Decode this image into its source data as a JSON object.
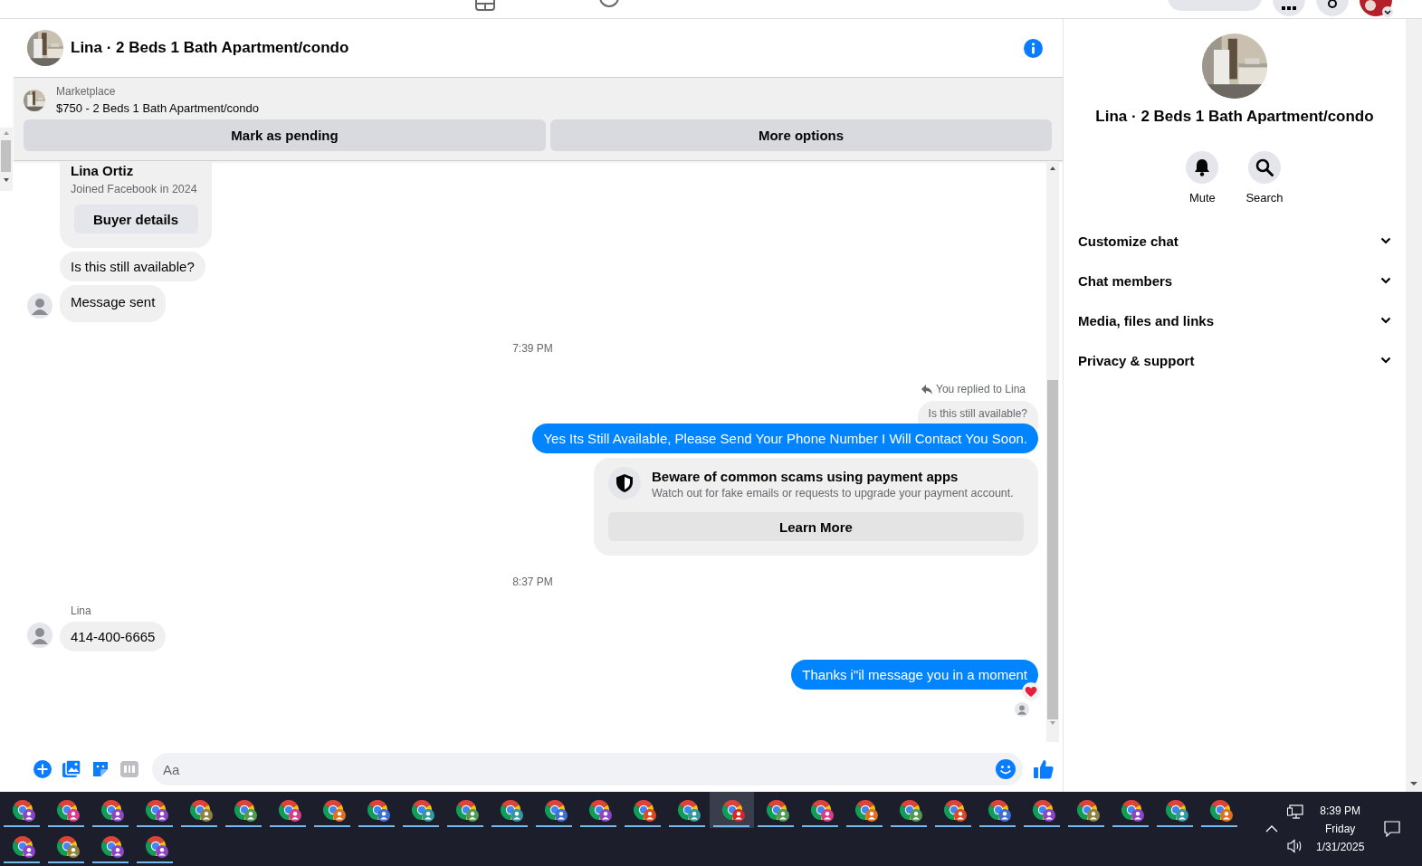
{
  "chat": {
    "title": "Lina · 2 Beds 1 Bath Apartment/condo",
    "listing": {
      "source": "Marketplace",
      "item": "$750 - 2 Beds 1 Bath Apartment/condo"
    },
    "actions": [
      "Mark as pending",
      "More options"
    ],
    "messages": [
      {
        "kind": "buyer_card",
        "name": "Lina Ortiz",
        "note": "Joined Facebook in 2024",
        "button": "Buyer details"
      },
      {
        "kind": "incoming",
        "text": "Is this still available?",
        "avatar": false
      },
      {
        "kind": "incoming",
        "text": "Message sent",
        "avatar": true
      },
      {
        "kind": "time",
        "text": "7:39 PM"
      },
      {
        "kind": "reply",
        "label": "You replied to Lina",
        "quoted": "Is this still available?",
        "text": "Yes Its Still Available, Please Send Your Phone Number I Will Contact You Soon."
      },
      {
        "kind": "warning",
        "title": "Beware of common scams using payment apps",
        "text": "Watch out for fake emails or requests to upgrade your payment account.",
        "button": "Learn More"
      },
      {
        "kind": "time",
        "text": "8:37 PM"
      },
      {
        "kind": "incoming",
        "sender": "Lina",
        "text": "414-400-6665",
        "avatar": true
      },
      {
        "kind": "outgoing",
        "text": "Thanks i\"il message you in a moment",
        "reacted": true,
        "seen": true
      }
    ],
    "composer": {
      "placeholder": "Aa"
    }
  },
  "details": {
    "title": "Lina · 2 Beds 1 Bath Apartment/condo",
    "actions": [
      {
        "kind": "mute",
        "label": "Mute"
      },
      {
        "kind": "search",
        "label": "Search"
      }
    ],
    "sections": [
      {
        "label": "Customize chat",
        "expanded": false
      },
      {
        "label": "Chat members",
        "expanded": false
      },
      {
        "label": "Media, files and links",
        "expanded": false
      },
      {
        "label": "Privacy & support",
        "expanded": false
      }
    ]
  },
  "taskbar": {
    "apps": [
      {
        "color": "#8e44c9",
        "selected": false
      },
      {
        "color": "#d63d8c",
        "selected": false
      },
      {
        "color": "#8e44c9",
        "selected": false
      },
      {
        "color": "#8e44c9",
        "selected": false
      },
      {
        "color": "#8f8240",
        "selected": false
      },
      {
        "color": "#4f9a55",
        "selected": false
      },
      {
        "color": "#d63d8c",
        "selected": false
      },
      {
        "color": "#e0701f",
        "selected": false
      },
      {
        "color": "#3d6fd6",
        "selected": false
      },
      {
        "color": "#2f9aa0",
        "selected": false
      },
      {
        "color": "#4f9a55",
        "selected": false
      },
      {
        "color": "#2f9aa0",
        "selected": false
      },
      {
        "color": "#3d6fd6",
        "selected": false
      },
      {
        "color": "#8e44c9",
        "selected": false
      },
      {
        "color": "#e0481f",
        "selected": false
      },
      {
        "color": "#2f9aa0",
        "selected": false
      },
      {
        "color": "#d6262b",
        "selected": true
      },
      {
        "color": "#4f9a55",
        "selected": false
      },
      {
        "color": "#d63d8c",
        "selected": false
      },
      {
        "color": "#e0701f",
        "selected": false
      },
      {
        "color": "#4f9a55",
        "selected": false
      },
      {
        "color": "#e0481f",
        "selected": false
      },
      {
        "color": "#3d6fd6",
        "selected": false
      },
      {
        "color": "#8e44c9",
        "selected": false
      },
      {
        "color": "#8f8240",
        "selected": false
      },
      {
        "color": "#8e44c9",
        "selected": false
      },
      {
        "color": "#2f9aa0",
        "selected": false
      },
      {
        "color": "#e0701f",
        "selected": false
      },
      {
        "color": "#8e44c9",
        "selected": false
      },
      {
        "color": "#8f8240",
        "selected": false
      },
      {
        "color": "#8e44c9",
        "selected": false
      },
      {
        "color": "#8e44c9",
        "selected": false
      }
    ],
    "clock": {
      "time": "8:39 PM",
      "day": "Friday",
      "date": "1/31/2025"
    }
  }
}
